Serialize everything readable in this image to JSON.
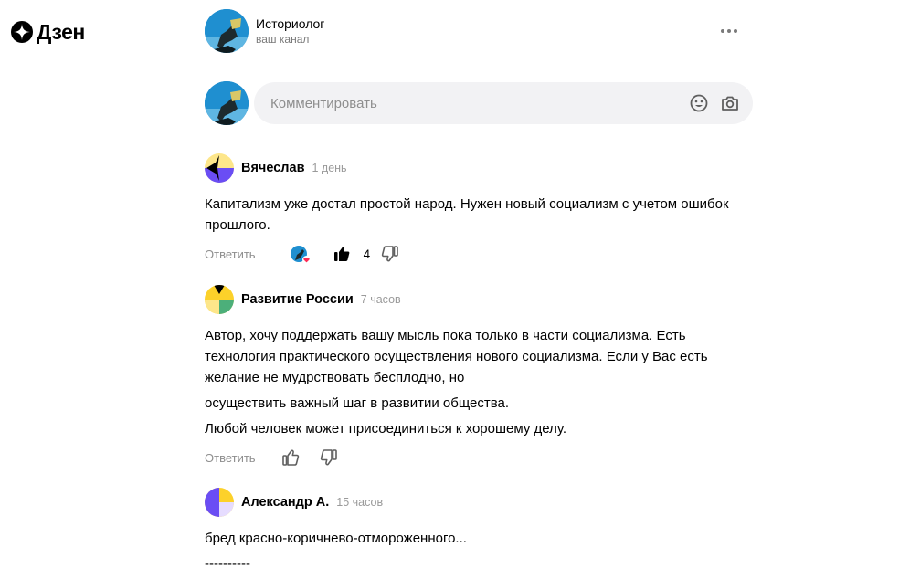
{
  "logo": {
    "text": "Дзен",
    "icon": "dzen-star-icon"
  },
  "channel": {
    "name": "Историолог",
    "subtitle": "ваш канал"
  },
  "composer": {
    "placeholder": "Комментировать",
    "icons": [
      "emoji-icon",
      "camera-icon"
    ]
  },
  "comments": [
    {
      "author": "Вячеслав",
      "time": "1 день",
      "paragraphs": [
        "Капитализм уже достал простой народ. Нужен новый социализм с учетом ошибок прошлого."
      ],
      "reply_label": "Ответить",
      "author_liked": true,
      "likes": "4",
      "liked": true
    },
    {
      "author": "Развитие России",
      "time": "7 часов",
      "paragraphs": [
        "Автор, хочу поддержать вашу мысль пока только в части социализма. Есть технология практического осуществления нового социализма. Если у Вас есть желание не мудрствовать бесплодно, но",
        "осуществить важный шаг в развитии общества.",
        "Любой человек может присоединиться к хорошему делу."
      ],
      "reply_label": "Ответить",
      "liked": false
    },
    {
      "author": "Александр А.",
      "time": "15 часов",
      "paragraphs": [
        "бред красно-коричнево-отмороженного...",
        "----------"
      ]
    }
  ],
  "colors": {
    "accent_yellow": "#fcd12a",
    "purple": "#6a4df4",
    "muted": "#8e8e8e",
    "input_bg": "#f2f2f4"
  }
}
